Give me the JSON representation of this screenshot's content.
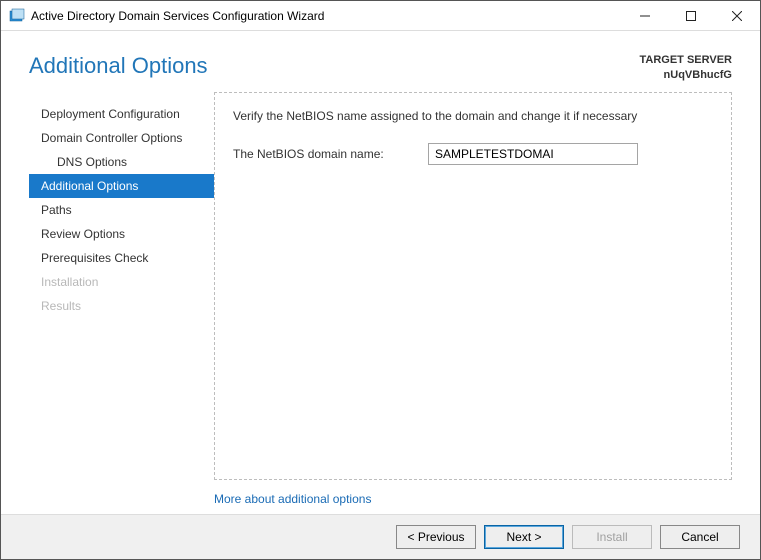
{
  "window": {
    "title": "Active Directory Domain Services Configuration Wizard"
  },
  "header": {
    "page_title": "Additional Options",
    "target_label": "TARGET SERVER",
    "target_name": "nUqVBhucfG"
  },
  "nav": {
    "items": [
      {
        "label": "Deployment Configuration",
        "indent": false,
        "active": false,
        "disabled": false
      },
      {
        "label": "Domain Controller Options",
        "indent": false,
        "active": false,
        "disabled": false
      },
      {
        "label": "DNS Options",
        "indent": true,
        "active": false,
        "disabled": false
      },
      {
        "label": "Additional Options",
        "indent": false,
        "active": true,
        "disabled": false
      },
      {
        "label": "Paths",
        "indent": false,
        "active": false,
        "disabled": false
      },
      {
        "label": "Review Options",
        "indent": false,
        "active": false,
        "disabled": false
      },
      {
        "label": "Prerequisites Check",
        "indent": false,
        "active": false,
        "disabled": false
      },
      {
        "label": "Installation",
        "indent": false,
        "active": false,
        "disabled": true
      },
      {
        "label": "Results",
        "indent": false,
        "active": false,
        "disabled": true
      }
    ]
  },
  "content": {
    "instruction": "Verify the NetBIOS name assigned to the domain and change it if necessary",
    "netbios_label": "The NetBIOS domain name:",
    "netbios_value": "SAMPLETESTDOMAI",
    "more_link": "More about additional options"
  },
  "footer": {
    "previous": "< Previous",
    "next": "Next >",
    "install": "Install",
    "cancel": "Cancel"
  }
}
